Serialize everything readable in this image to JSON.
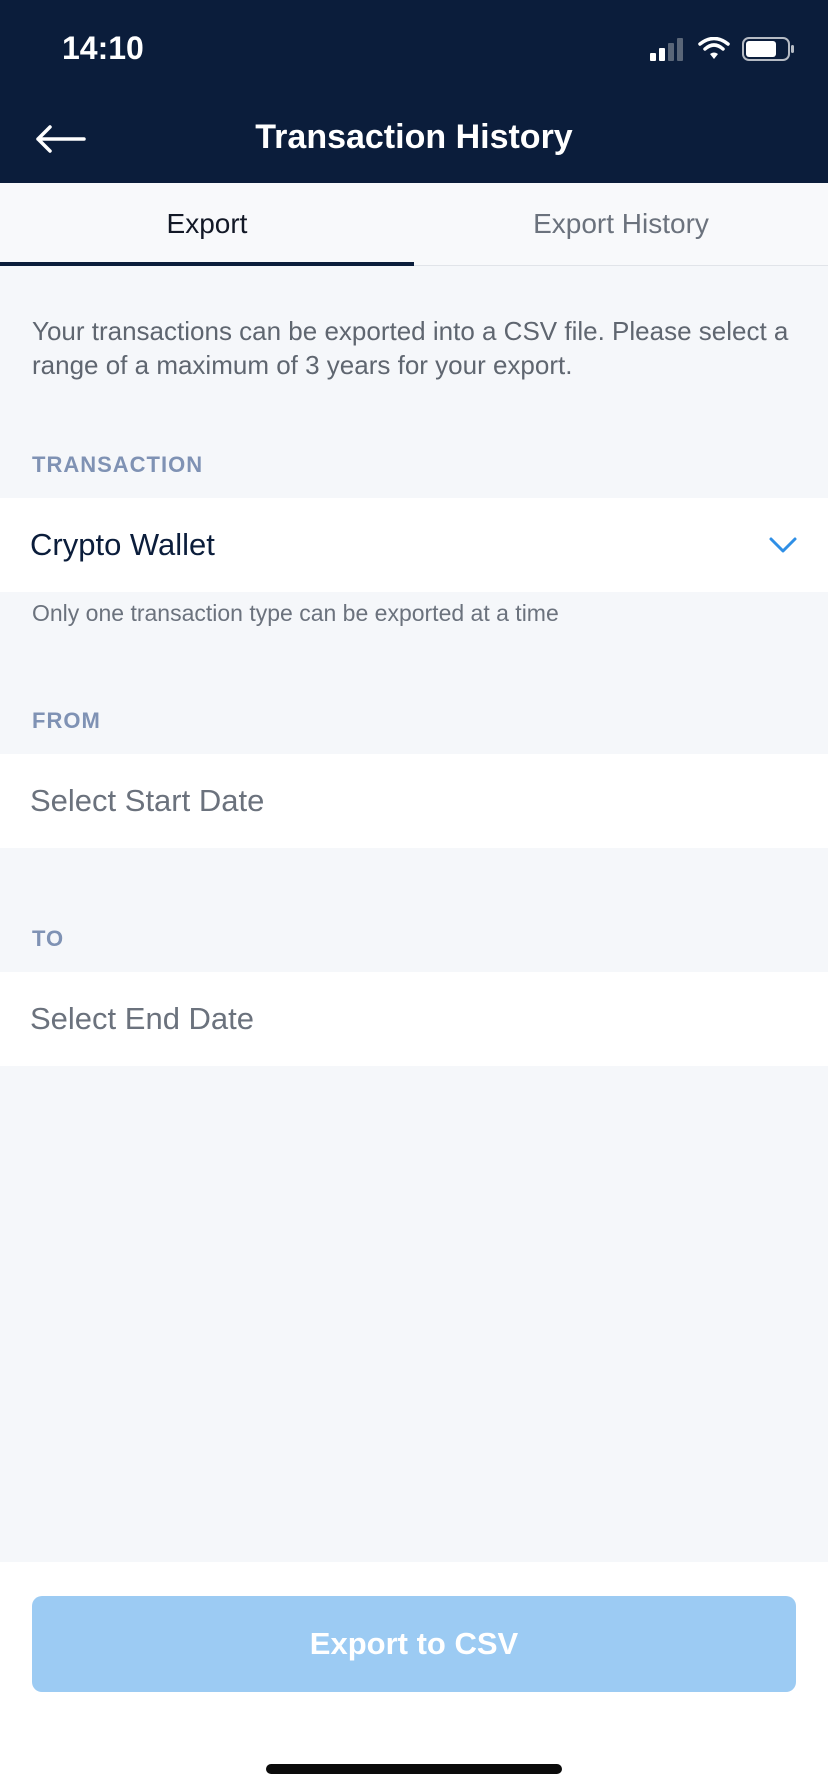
{
  "status_bar": {
    "time": "14:10",
    "icons": [
      "signal-icon",
      "wifi-icon",
      "battery-icon"
    ]
  },
  "header": {
    "title": "Transaction History",
    "back_icon": "arrow-left-icon"
  },
  "tabs": [
    {
      "label": "Export",
      "active": true
    },
    {
      "label": "Export History",
      "active": false
    }
  ],
  "description": "Your transactions can be exported into a CSV file. Please select a range of a maximum of 3 years for your export.",
  "transaction": {
    "label": "TRANSACTION",
    "value": "Crypto Wallet",
    "hint": "Only one transaction type can be exported at a time",
    "icon": "chevron-down-icon"
  },
  "from": {
    "label": "FROM",
    "placeholder": "Select Start Date"
  },
  "to": {
    "label": "TO",
    "placeholder": "Select End Date"
  },
  "export_button": {
    "label": "Export to CSV"
  },
  "colors": {
    "header_bg": "#0b1d3b",
    "accent": "#2f8fe6",
    "button_disabled": "#9ccbf3",
    "page_bg": "#f5f7fa",
    "label": "#7f92b4"
  }
}
